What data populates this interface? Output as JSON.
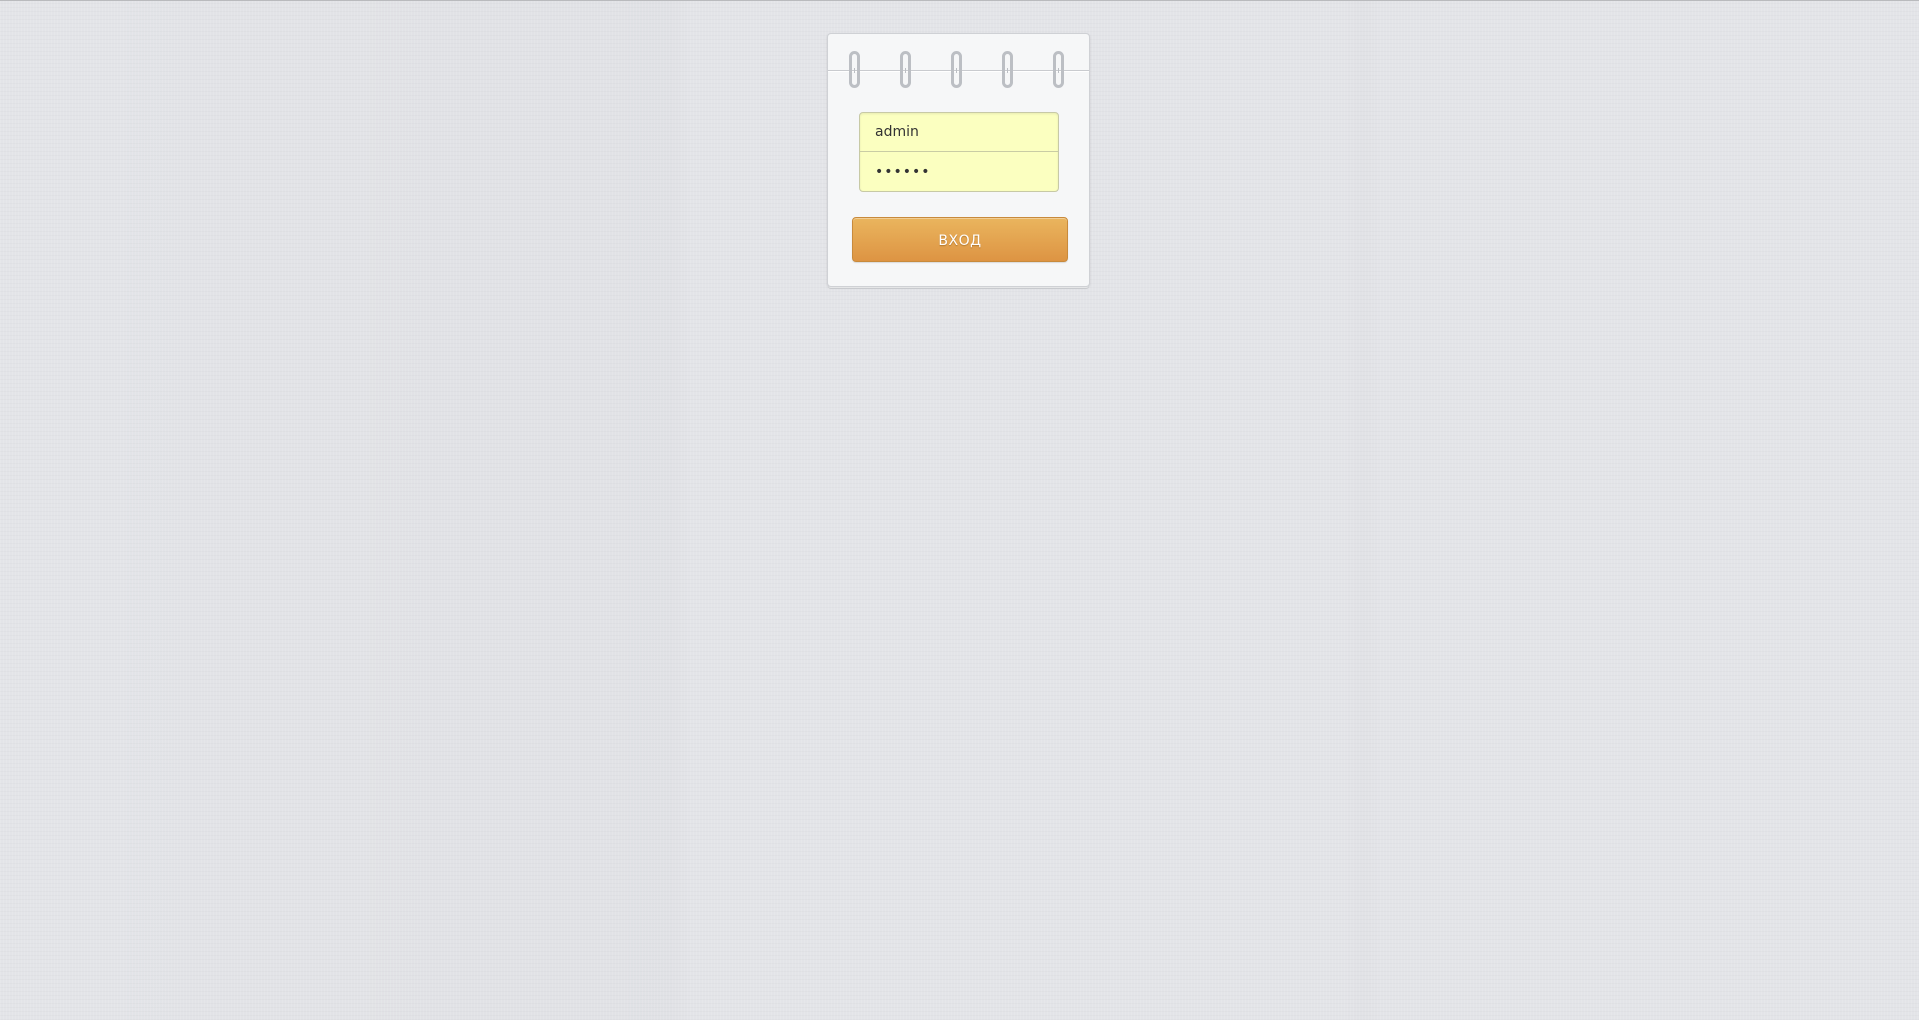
{
  "form": {
    "username_value": "admin",
    "password_value": "••••••",
    "submit_label": "ВХОД"
  },
  "colors": {
    "page_background": "#e3e4e8",
    "input_background": "#fbffc0",
    "button_top": "#eab55e",
    "button_bottom": "#dd9443",
    "button_text": "#ffffff"
  }
}
